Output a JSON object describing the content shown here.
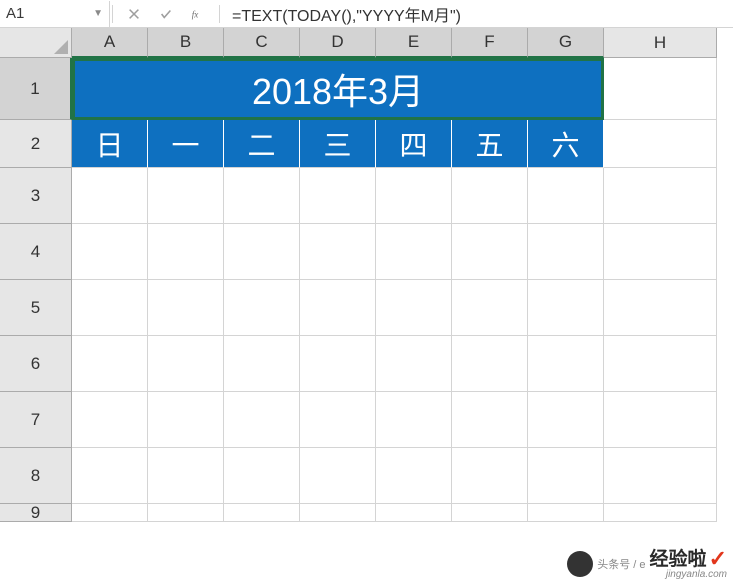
{
  "formula_bar": {
    "cell_reference": "A1",
    "formula": "=TEXT(TODAY(),\"YYYY年M月\")"
  },
  "columns": [
    "A",
    "B",
    "C",
    "D",
    "E",
    "F",
    "G",
    "H"
  ],
  "rows": [
    "1",
    "2",
    "3",
    "4",
    "5",
    "6",
    "7",
    "8",
    "9"
  ],
  "title_cell": "2018年3月",
  "day_headers": [
    "日",
    "一",
    "二",
    "三",
    "四",
    "五",
    "六"
  ],
  "watermark": {
    "source": "头条号 / e",
    "logo": "经验啦",
    "check": "✓",
    "sub": "jingyanla.com"
  }
}
